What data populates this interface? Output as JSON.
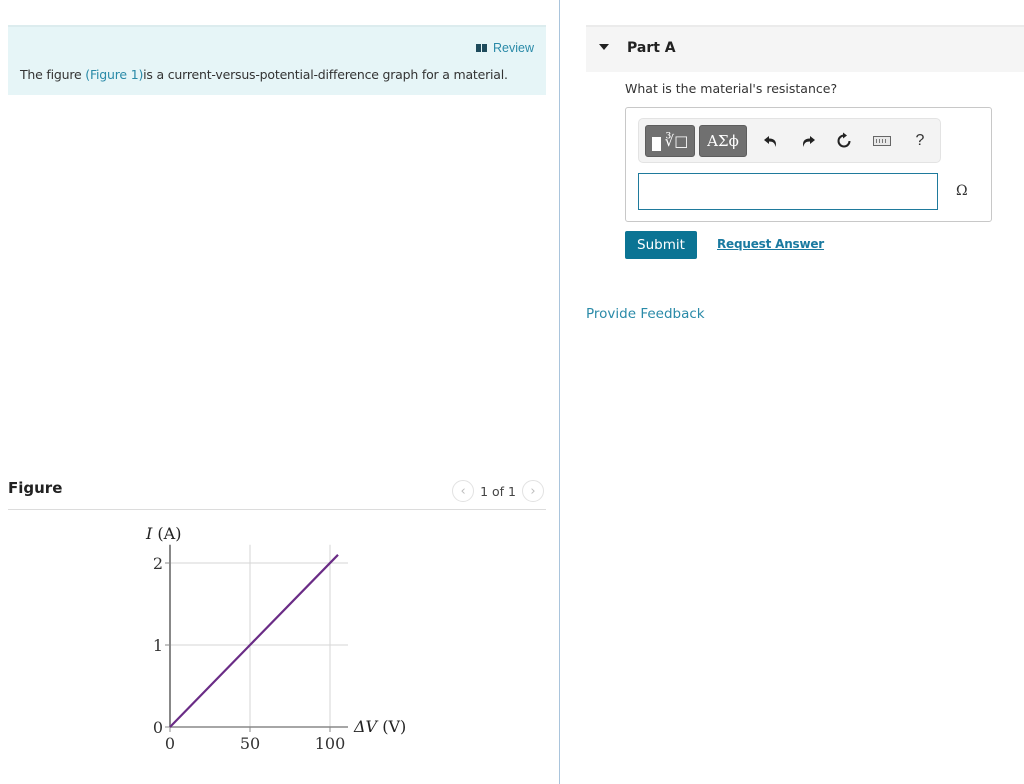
{
  "intro": {
    "review_label": "Review",
    "text_before": "The figure ",
    "figure_link": "(Figure 1)",
    "text_after": "is a current-versus-potential-difference graph for a material."
  },
  "figure": {
    "title": "Figure",
    "pager_text": "1 of 1",
    "prev_icon": "chevron-left-icon",
    "next_icon": "chevron-right-icon"
  },
  "part": {
    "title": "Part A",
    "question": "What is the material's resistance?",
    "toolbar": {
      "templates_icon": "templates-icon",
      "greek_label": "ΑΣϕ",
      "undo_icon": "undo-icon",
      "redo_icon": "redo-icon",
      "reset_icon": "reset-icon",
      "keyboard_icon": "keyboard-icon",
      "help_label": "?"
    },
    "answer_value": "",
    "unit": "Ω",
    "submit_label": "Submit",
    "request_answer_label": "Request Answer"
  },
  "feedback_label": "Provide Feedback",
  "colors": {
    "accent": "#0b7494",
    "link": "#2a8aa8",
    "intro_bg": "#e6f5f7",
    "line": "#6a2c86"
  },
  "chart_data": {
    "type": "line",
    "title": "",
    "ylabel_italic": "I",
    "ylabel_unit": "(A)",
    "xlabel_italic": "ΔV",
    "xlabel_unit": "(V)",
    "xlim": [
      0,
      110
    ],
    "ylim": [
      0,
      2.15
    ],
    "x_ticks": [
      0,
      50,
      100
    ],
    "y_ticks": [
      0,
      1,
      2
    ],
    "x_tick_labels": [
      "0",
      "50",
      "100"
    ],
    "y_tick_labels": [
      "0",
      "1",
      "2"
    ],
    "grid": true,
    "series": [
      {
        "name": "I vs ΔV",
        "x": [
          0,
          50,
          105
        ],
        "y": [
          0,
          1,
          2.1
        ]
      }
    ]
  }
}
